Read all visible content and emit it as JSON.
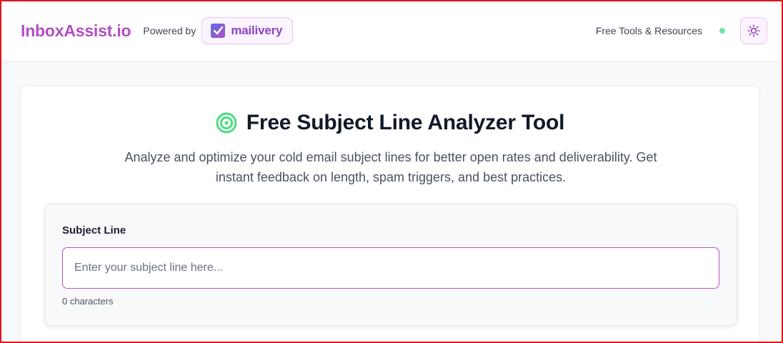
{
  "header": {
    "logo": "InboxAssist.io",
    "powered_by": "Powered by",
    "partner_badge": {
      "label": "mailivery",
      "icon": "mailivery-logo-icon"
    },
    "resources_link": "Free Tools & Resources",
    "status_color": "#6ee7a7",
    "theme_toggle_icon": "sun-icon"
  },
  "main": {
    "title_icon": "target-icon",
    "title": "Free Subject Line Analyzer Tool",
    "subtitle": "Analyze and optimize your cold email subject lines for better open rates and deliverability. Get instant feedback on length, spam triggers, and best practices.",
    "form": {
      "label": "Subject Line",
      "value": "",
      "placeholder": "Enter your subject line here...",
      "char_count": "0 characters"
    }
  },
  "colors": {
    "brand": "#b44cc6",
    "partner": "#8a45c8",
    "accent_green": "#4ade80",
    "input_border": "#bb52c2"
  }
}
